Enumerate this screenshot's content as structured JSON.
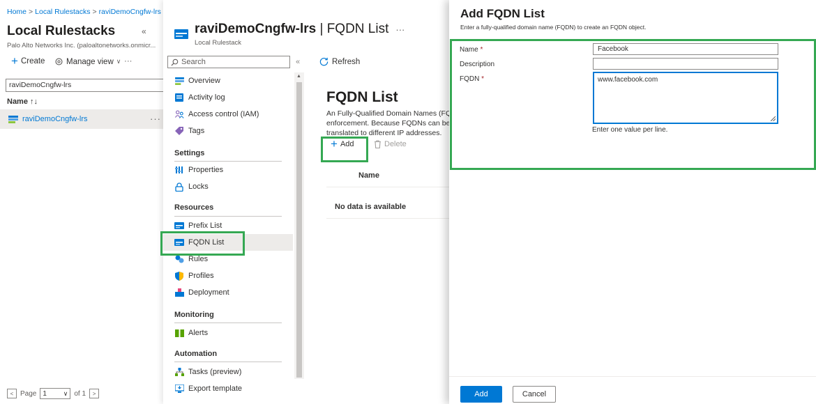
{
  "breadcrumb": {
    "items": [
      "Home",
      "Local Rulestacks",
      "raviDemoCngfw-lrs"
    ]
  },
  "left_pane": {
    "title": "Local Rulestacks",
    "subtitle": "Palo Alto Networks Inc. (paloaltonetworks.onmicr...",
    "toolbar": {
      "create": "Create",
      "manage_view": "Manage view",
      "more": "···"
    },
    "filter_value": "raviDemoCngfw-lrs",
    "column_header": "Name ↑↓",
    "rows": [
      {
        "name": "raviDemoCngfw-lrs",
        "more": "···"
      }
    ],
    "pager": {
      "page_label": "Page",
      "page_value": "1",
      "of_label": "of 1"
    }
  },
  "resource": {
    "name": "raviDemoCngfw-lrs",
    "separator": " | ",
    "page": "FQDN List",
    "more": "···",
    "type": "Local Rulestack",
    "search_placeholder": "Search",
    "collapse": "«"
  },
  "menu": {
    "items": [
      {
        "label": "Overview",
        "icon": "overview-icon"
      },
      {
        "label": "Activity log",
        "icon": "activity-log-icon"
      },
      {
        "label": "Access control (IAM)",
        "icon": "access-control-icon"
      },
      {
        "label": "Tags",
        "icon": "tag-icon"
      }
    ],
    "sections": {
      "settings": "Settings",
      "resources": "Resources",
      "monitoring": "Monitoring",
      "automation": "Automation"
    },
    "settings_items": [
      {
        "label": "Properties"
      },
      {
        "label": "Locks"
      }
    ],
    "resources_items": [
      {
        "label": "Prefix List"
      },
      {
        "label": "FQDN List"
      },
      {
        "label": "Rules"
      },
      {
        "label": "Profiles"
      },
      {
        "label": "Deployment"
      }
    ],
    "monitoring_items": [
      {
        "label": "Alerts"
      }
    ],
    "automation_items": [
      {
        "label": "Tasks (preview)"
      },
      {
        "label": "Export template"
      }
    ]
  },
  "content": {
    "refresh": "Refresh",
    "title": "FQDN List",
    "description_lines": [
      "An Fully-Qualified Domain Names (FQ",
      "enforcement. Because FQDNs can be",
      "translated to different IP addresses."
    ],
    "add": "Add",
    "delete": "Delete",
    "table_header": "Name",
    "empty": "No data is available"
  },
  "blade": {
    "title": "Add FQDN List",
    "subtitle": "Enter a fully-qualified domain name (FQDN) to create an FQDN object.",
    "fields": {
      "name_label": "Name",
      "name_value": "Facebook",
      "description_label": "Description",
      "description_value": "",
      "fqdn_label": "FQDN",
      "fqdn_value": "www.facebook.com",
      "required_mark": "*"
    },
    "hint": "Enter one value per line.",
    "add_button": "Add",
    "cancel_button": "Cancel"
  },
  "colors": {
    "accent": "#0078d4",
    "highlight": "#35a853",
    "required": "#a4262c"
  }
}
